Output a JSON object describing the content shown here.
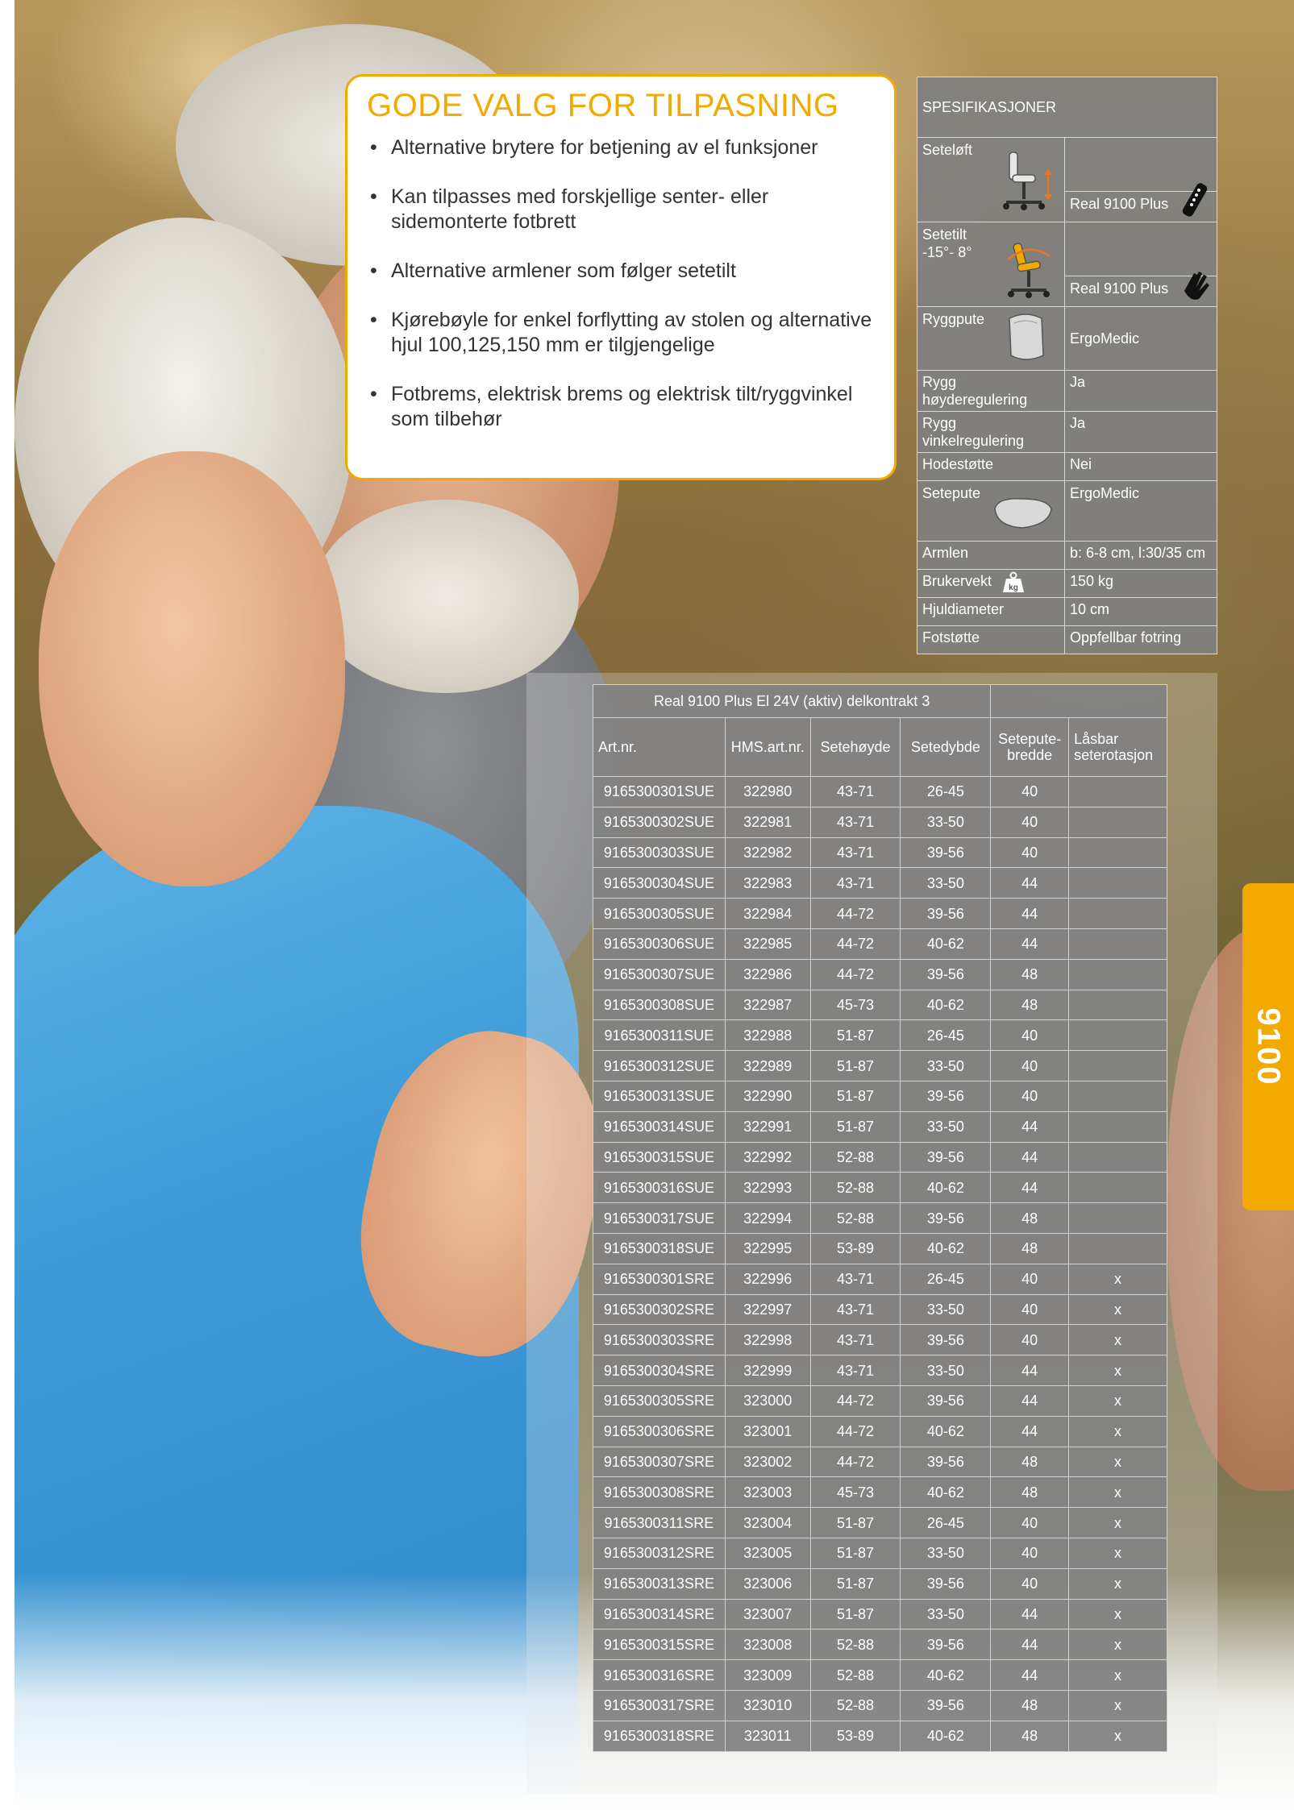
{
  "callout": {
    "title": "GODE VALG FOR TILPASNING",
    "bullets": [
      "Alternative brytere for betjening av el funksjoner",
      "Kan tilpasses med forskjellige senter- eller sidemonterte fotbrett",
      "Alternative armlener som følger setetilt",
      "Kjørebøyle for enkel forflytting av stolen og alternative hjul 100,125,150 mm er tilgjengelige",
      "Fotbrems, elektrisk brems og elektrisk tilt/ryggvinkel som tilbehør"
    ]
  },
  "spec": {
    "header": "SPESIFIKASJONER",
    "seteloft_label": "Seteløft",
    "seteloft_value": "Real 9100 Plus",
    "setetilt_label": "Setetilt",
    "setetilt_range": "-15°- 8°",
    "setetilt_value": "Real 9100 Plus",
    "ryggpute_label": "Ryggpute",
    "ryggpute_value": "ErgoMedic",
    "rygg_hoyde_label": "Rygg høyderegulering",
    "rygg_hoyde_value": "Ja",
    "rygg_vinkel_label": "Rygg vinkelregulering",
    "rygg_vinkel_value": "Ja",
    "hodestotte_label": "Hodestøtte",
    "hodestotte_value": "Nei",
    "setepute_label": "Setepute",
    "setepute_value": "ErgoMedic",
    "armlen_label": "Armlen",
    "armlen_value": "b: 6-8 cm, l:30/35 cm",
    "brukervekt_label": "Brukervekt",
    "brukervekt_icon_text": "kg",
    "brukervekt_value": "150 kg",
    "hjuldiameter_label": "Hjuldiameter",
    "hjuldiameter_value": "10 cm",
    "fotstotte_label": "Fotstøtte",
    "fotstotte_value": "Oppfellbar fotring"
  },
  "products": {
    "title": "Real 9100 Plus El 24V (aktiv) delkontrakt 3",
    "headers": [
      "Art.nr.",
      "HMS.art.nr.",
      "Setehøyde",
      "Setedybde",
      "Setepute-\nbredde",
      "Låsbar\nseterotasjon"
    ],
    "rows": [
      [
        "9165300301SUE",
        "322980",
        "43-71",
        "26-45",
        "40",
        ""
      ],
      [
        "9165300302SUE",
        "322981",
        "43-71",
        "33-50",
        "40",
        ""
      ],
      [
        "9165300303SUE",
        "322982",
        "43-71",
        "39-56",
        "40",
        ""
      ],
      [
        "9165300304SUE",
        "322983",
        "43-71",
        "33-50",
        "44",
        ""
      ],
      [
        "9165300305SUE",
        "322984",
        "44-72",
        "39-56",
        "44",
        ""
      ],
      [
        "9165300306SUE",
        "322985",
        "44-72",
        "40-62",
        "44",
        ""
      ],
      [
        "9165300307SUE",
        "322986",
        "44-72",
        "39-56",
        "48",
        ""
      ],
      [
        "9165300308SUE",
        "322987",
        "45-73",
        "40-62",
        "48",
        ""
      ],
      [
        "9165300311SUE",
        "322988",
        "51-87",
        "26-45",
        "40",
        ""
      ],
      [
        "9165300312SUE",
        "322989",
        "51-87",
        "33-50",
        "40",
        ""
      ],
      [
        "9165300313SUE",
        "322990",
        "51-87",
        "39-56",
        "40",
        ""
      ],
      [
        "9165300314SUE",
        "322991",
        "51-87",
        "33-50",
        "44",
        ""
      ],
      [
        "9165300315SUE",
        "322992",
        "52-88",
        "39-56",
        "44",
        ""
      ],
      [
        "9165300316SUE",
        "322993",
        "52-88",
        "40-62",
        "44",
        ""
      ],
      [
        "9165300317SUE",
        "322994",
        "52-88",
        "39-56",
        "48",
        ""
      ],
      [
        "9165300318SUE",
        "322995",
        "53-89",
        "40-62",
        "48",
        ""
      ],
      [
        "9165300301SRE",
        "322996",
        "43-71",
        "26-45",
        "40",
        "x"
      ],
      [
        "9165300302SRE",
        "322997",
        "43-71",
        "33-50",
        "40",
        "x"
      ],
      [
        "9165300303SRE",
        "322998",
        "43-71",
        "39-56",
        "40",
        "x"
      ],
      [
        "9165300304SRE",
        "322999",
        "43-71",
        "33-50",
        "44",
        "x"
      ],
      [
        "9165300305SRE",
        "323000",
        "44-72",
        "39-56",
        "44",
        "x"
      ],
      [
        "9165300306SRE",
        "323001",
        "44-72",
        "40-62",
        "44",
        "x"
      ],
      [
        "9165300307SRE",
        "323002",
        "44-72",
        "39-56",
        "48",
        "x"
      ],
      [
        "9165300308SRE",
        "323003",
        "45-73",
        "40-62",
        "48",
        "x"
      ],
      [
        "9165300311SRE",
        "323004",
        "51-87",
        "26-45",
        "40",
        "x"
      ],
      [
        "9165300312SRE",
        "323005",
        "51-87",
        "33-50",
        "40",
        "x"
      ],
      [
        "9165300313SRE",
        "323006",
        "51-87",
        "39-56",
        "40",
        "x"
      ],
      [
        "9165300314SRE",
        "323007",
        "51-87",
        "33-50",
        "44",
        "x"
      ],
      [
        "9165300315SRE",
        "323008",
        "52-88",
        "39-56",
        "44",
        "x"
      ],
      [
        "9165300316SRE",
        "323009",
        "52-88",
        "40-62",
        "44",
        "x"
      ],
      [
        "9165300317SRE",
        "323010",
        "52-88",
        "39-56",
        "48",
        "x"
      ],
      [
        "9165300318SRE",
        "323011",
        "53-89",
        "40-62",
        "48",
        "x"
      ]
    ]
  },
  "side_tab": "9100",
  "colors": {
    "accent": "#f2a900",
    "table_bg": "#828282",
    "text": "#333333"
  }
}
